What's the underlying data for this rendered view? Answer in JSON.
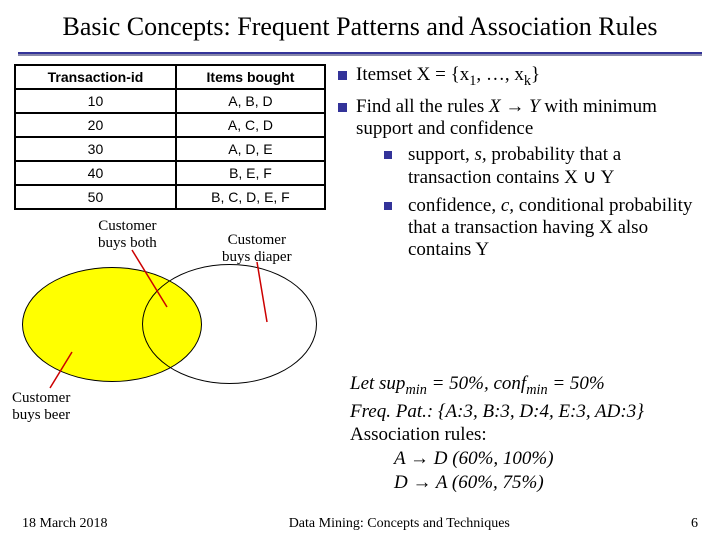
{
  "title": "Basic Concepts: Frequent Patterns and Association Rules",
  "table": {
    "headers": [
      "Transaction-id",
      "Items bought"
    ],
    "rows": [
      [
        "10",
        "A, B, D"
      ],
      [
        "20",
        "A, C, D"
      ],
      [
        "30",
        "A, D, E"
      ],
      [
        "40",
        "B, E, F"
      ],
      [
        "50",
        "B, C, D, E, F"
      ]
    ]
  },
  "venn": {
    "label_both_l1": "Customer",
    "label_both_l2": "buys both",
    "label_diaper_l1": "Customer",
    "label_diaper_l2": "buys diaper",
    "label_beer_l1": "Customer",
    "label_beer_l2": "buys beer"
  },
  "bullets": {
    "b1_pre": "Itemset X = {x",
    "b1_sub1": "1",
    "b1_mid": ", …, x",
    "b1_sub2": "k",
    "b1_post": "}",
    "b2_pre": "Find all the rules ",
    "b2_xy": "X → Y",
    "b2_post": " with minimum support and confidence",
    "n1_a": "support, ",
    "n1_b": "s,",
    "n1_c": " probability that a transaction contains X ∪ Y",
    "n2_a": "confidence, ",
    "n2_b": "c,",
    "n2_c": " conditional probability that a transaction having X also contains Y"
  },
  "example": {
    "l1_a": "Let  sup",
    "l1_b": "min",
    "l1_c": " = 50%,  conf",
    "l1_d": "min",
    "l1_e": " = 50%",
    "l2": "Freq. Pat.: {A:3, B:3, D:4, E:3, AD:3}",
    "l3": "Association rules:",
    "l4_a": "A ",
    "l4_b": " D  (60%, 100%)",
    "l5_a": "D ",
    "l5_b": " A  (60%, 75%)"
  },
  "footer": {
    "date": "18 March 2018",
    "center": "Data Mining: Concepts and Techniques",
    "page": "6"
  }
}
